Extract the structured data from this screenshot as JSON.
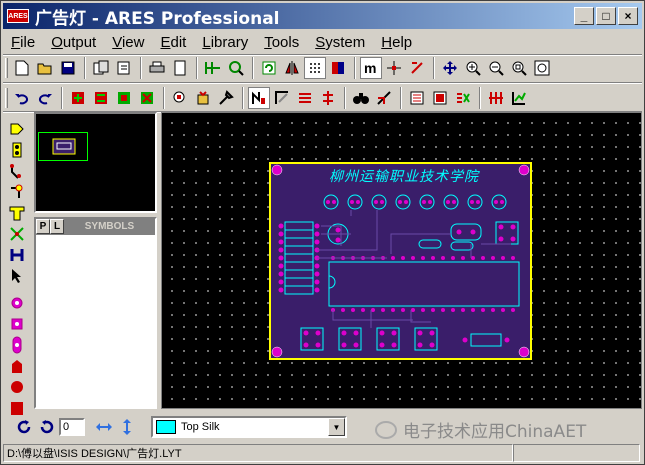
{
  "window": {
    "logo_text": "ARES",
    "title": "广告灯 - ARES Professional",
    "min_symbol": "_",
    "max_symbol": "□",
    "close_symbol": "×"
  },
  "menu": [
    {
      "label": "File",
      "accel": "F"
    },
    {
      "label": "Output",
      "accel": "O"
    },
    {
      "label": "View",
      "accel": "V"
    },
    {
      "label": "Edit",
      "accel": "E"
    },
    {
      "label": "Library",
      "accel": "L"
    },
    {
      "label": "Tools",
      "accel": "T"
    },
    {
      "label": "System",
      "accel": "S"
    },
    {
      "label": "Help",
      "accel": "H"
    }
  ],
  "toolbar1": [
    "new-file-icon",
    "open-folder-icon",
    "save-icon",
    "import-icon",
    "export-icon",
    "print-icon",
    "page-icon",
    "grid-origin-icon",
    "zoom-region-icon",
    "refresh-icon",
    "flip-icon",
    "grid-dots-icon",
    "layers-icon",
    "metric-icon",
    "origin-icon",
    "crosshair-icon",
    "pan-icon",
    "zoom-in-icon",
    "zoom-out-icon",
    "zoom-all-icon",
    "zoom-area-icon"
  ],
  "toolbar2": [
    "undo-icon",
    "redo-icon",
    "tag-icon",
    "block-copy-icon",
    "block-move-icon",
    "block-delete-icon",
    "pick-icon",
    "package-icon",
    "tools-icon",
    "autoplace-icon",
    "autoroute-icon",
    "ratsnest-icon",
    "power-plane-icon",
    "search-icon",
    "design-rule-icon",
    "netlist-icon",
    "connectivity-icon",
    "drc-icon",
    "graph-icon"
  ],
  "lefttools": [
    "component-icon",
    "package-pad-icon",
    "track-icon",
    "via-icon",
    "zone-icon",
    "ratsnest-mode-icon",
    "connectivity-icon",
    "select-icon",
    "circle-pad-icon",
    "square-pad-icon",
    "dil-pad-icon",
    "edge-pad-icon",
    "circle-icon",
    "sm-pad-icon"
  ],
  "selector": {
    "tab_p": "P",
    "tab_l": "L",
    "title": "SYMBOLS"
  },
  "pcb": {
    "title": "柳州运输职业技术学院",
    "labels": [
      "R1",
      "R2",
      "R3",
      "R4",
      "R5",
      "R6",
      "R7",
      "R8",
      "C1",
      "C2",
      "C3",
      "X1",
      "U1",
      "U2",
      "U3",
      "U4",
      "U5",
      "U6",
      "R10",
      "R9",
      "D1",
      "D2",
      "D3",
      "D4",
      "D5",
      "D6",
      "D7",
      "D8",
      "S"
    ]
  },
  "bottom": {
    "rotation_value": "0",
    "layer_name": "Top Silk",
    "layer_color": "#00ffff",
    "watermark": "电子技术应用ChinaAET"
  },
  "status": {
    "path": "D:\\傅以盘\\ISIS DESIGN\\广告灯.LYT"
  }
}
